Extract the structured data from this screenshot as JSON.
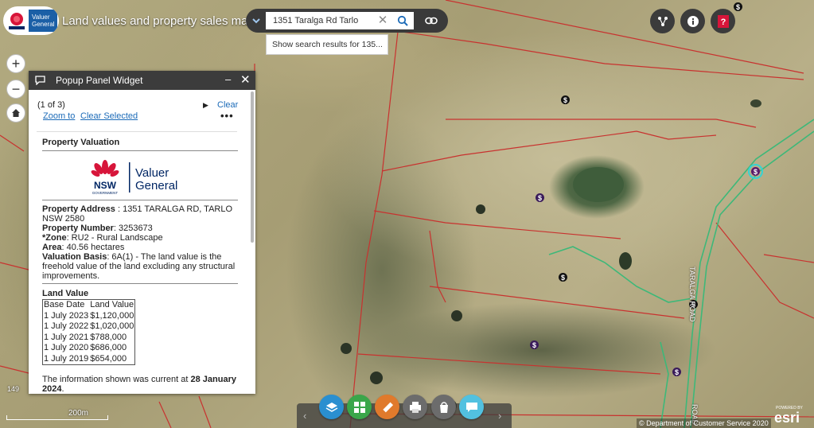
{
  "header": {
    "logo_line1": "Valuer",
    "logo_line2": "General",
    "title": "Land values and property sales map"
  },
  "search": {
    "value": "1351 Taralga Rd Tarlo",
    "suggestion": "Show search results for 135..."
  },
  "map": {
    "road_label": "TARALGA ROAD",
    "road_label_2": "ROAD",
    "scale_label": "200m",
    "coord_label": "149",
    "copyright": "© Department of Customer Service 2020",
    "powered_by": "POWERED BY",
    "esri": "esri",
    "marker_symbol": "$"
  },
  "popup": {
    "title": "Popup Panel Widget",
    "minimize_glyph": "–",
    "close_glyph": "✕",
    "pager": "(1 of 3)",
    "clear": "Clear",
    "zoom_to": "Zoom to",
    "clear_selected": "Clear Selected",
    "more": "•••",
    "section_title": "Property Valuation",
    "vg_logo_nsw": "NSW",
    "vg_logo_gov": "GOVERNMENT",
    "vg_logo_line1": "Valuer",
    "vg_logo_line2": "General",
    "address_label": "Property Address",
    "address_value": " : 1351 TARALGA RD, TARLO NSW 2580",
    "number_label": "Property Number",
    "number_value": ": 3253673",
    "zone_label": "*Zone",
    "zone_value": ": RU2 - Rural Landscape",
    "area_label": "Area",
    "area_value": ": 40.56 hectares",
    "basis_label": "Valuation Basis",
    "basis_value": ": 6A(1) - The land value is the freehold value of the land excluding any structural improvements.",
    "land_value_title": "Land Value",
    "table_headers": [
      "Base Date",
      "Land Value"
    ],
    "table_rows": [
      [
        "1 July 2023",
        "$1,120,000"
      ],
      [
        "1 July 2022",
        "$1,020,000"
      ],
      [
        "1 July 2021",
        "$788,000"
      ],
      [
        "1 July 2020",
        "$686,000"
      ],
      [
        "1 July 2019",
        "$654,000"
      ]
    ],
    "note_prefix": "The information shown was current at ",
    "note_date": "28 January 2024",
    "note_suffix": "."
  },
  "icons": {
    "top_right": [
      "share-network-icon",
      "info-icon",
      "help-icon"
    ],
    "toolbar": [
      "layers-icon",
      "basemap-grid-icon",
      "measure-ruler-icon",
      "print-icon",
      "bookmark-bag-icon",
      "comment-icon"
    ]
  },
  "colors": {
    "toolbar_layers": "#2a8fd0",
    "toolbar_grid": "#3aa64a",
    "toolbar_measure": "#e07a2c",
    "toolbar_print": "#6c6c6c",
    "toolbar_bag": "#6c6c6c",
    "toolbar_comment": "#52c1e0",
    "parcel_line": "#c8322f",
    "road_line": "#3db879"
  }
}
